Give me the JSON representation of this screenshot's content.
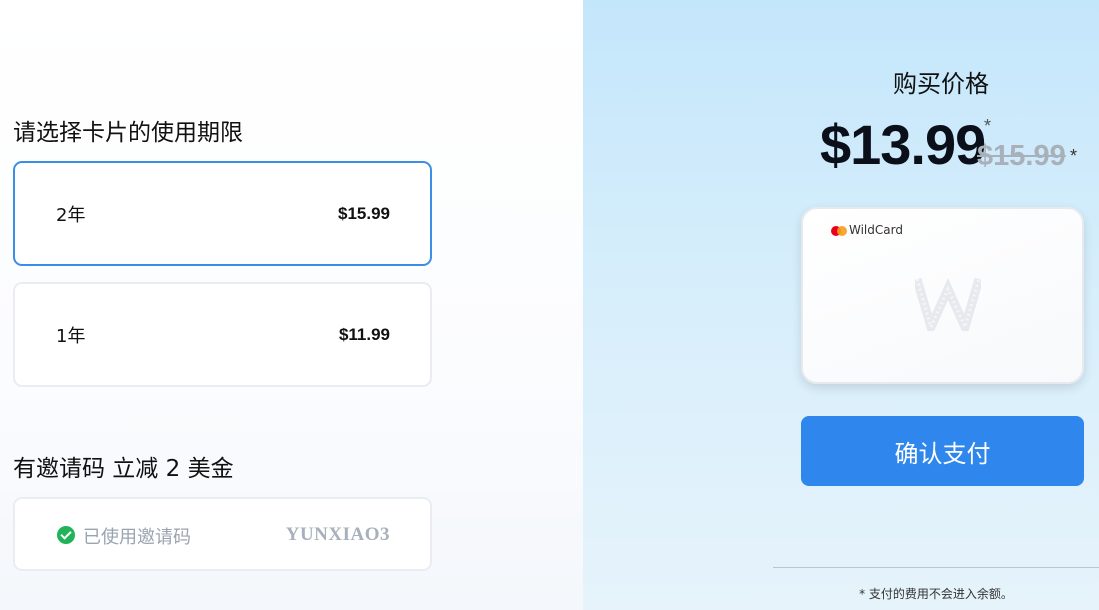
{
  "period_section": {
    "title": "请选择卡片的使用期限",
    "options": [
      {
        "name": "2年",
        "price": "$15.99",
        "selected": true
      },
      {
        "name": "1年",
        "price": "$11.99",
        "selected": false
      }
    ]
  },
  "invite_section": {
    "title": "有邀请码 立减 2 美金",
    "status": "已使用邀请码",
    "code": "YUNXIAO3"
  },
  "summary": {
    "label": "购买价格",
    "price_now": "$13.99",
    "price_now_mark": "*",
    "price_old": "$15.99",
    "price_old_mark": "*",
    "card_brand": "WildCard",
    "confirm_label": "确认支付",
    "footnote": "* 支付的费用不会进入余额。"
  },
  "colors": {
    "accent": "#2f86ec",
    "selected_border": "#3a8ee6",
    "success": "#22b35a"
  }
}
